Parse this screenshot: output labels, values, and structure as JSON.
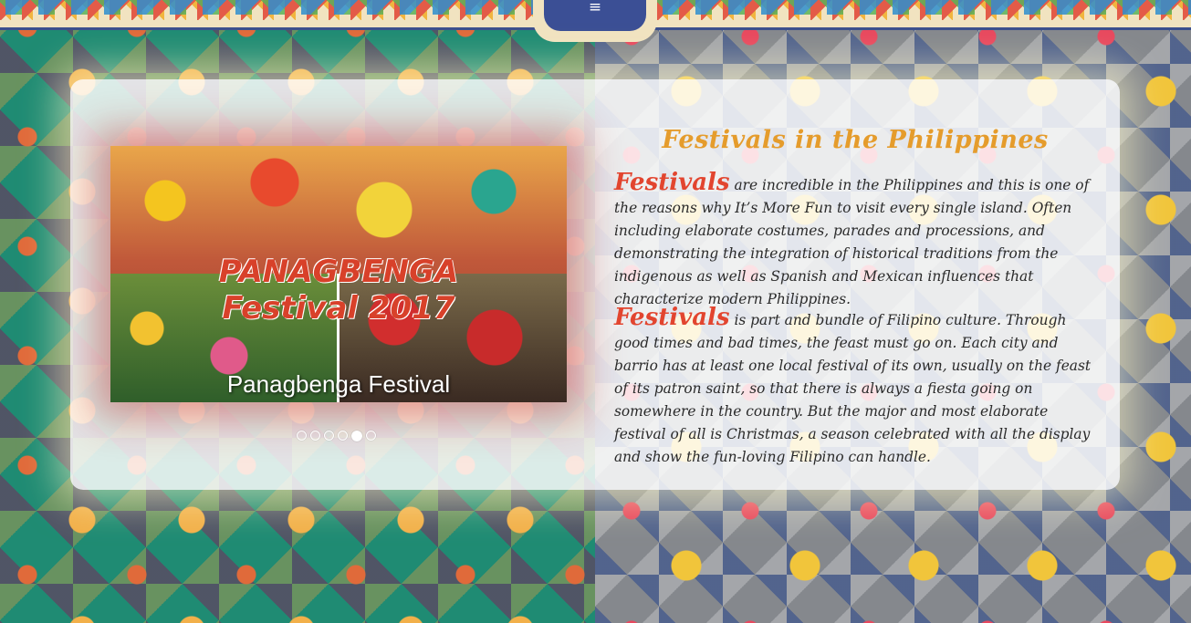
{
  "nav": {
    "menu_icon": "≡"
  },
  "slider": {
    "caption": "Panagbenga Festival",
    "logo_text": "PANAGBENGA Festival 2017",
    "dots": [
      false,
      false,
      false,
      false,
      true,
      false
    ]
  },
  "content": {
    "heading": "Festivals in the Philippines",
    "paragraphs": [
      {
        "lead": "Festivals",
        "text": " are incredible in the Philippines and this is one of the reasons why It’s More Fun to visit every single island. Often including elaborate costumes, parades and processions, and demonstrating the integration of historical traditions from the indigenous as well as Spanish and Mexican influences that characterize modern Philippines."
      },
      {
        "lead": "Festivals",
        "text": " is part and bundle of Filipino culture. Through good times and bad times, the feast must go on. Each city and barrio has at least one local festival of its own, usually on the feast of its patron saint, so that there is always a fiesta going on somewhere in the country. But the major and most elaborate festival of all is Christmas, a season celebrated with all the display and show the fun-loving Filipino can handle."
      }
    ]
  },
  "colors": {
    "heading": "#e59c2c",
    "lead": "#e2452f",
    "nav_tab": "#3b4f95"
  }
}
